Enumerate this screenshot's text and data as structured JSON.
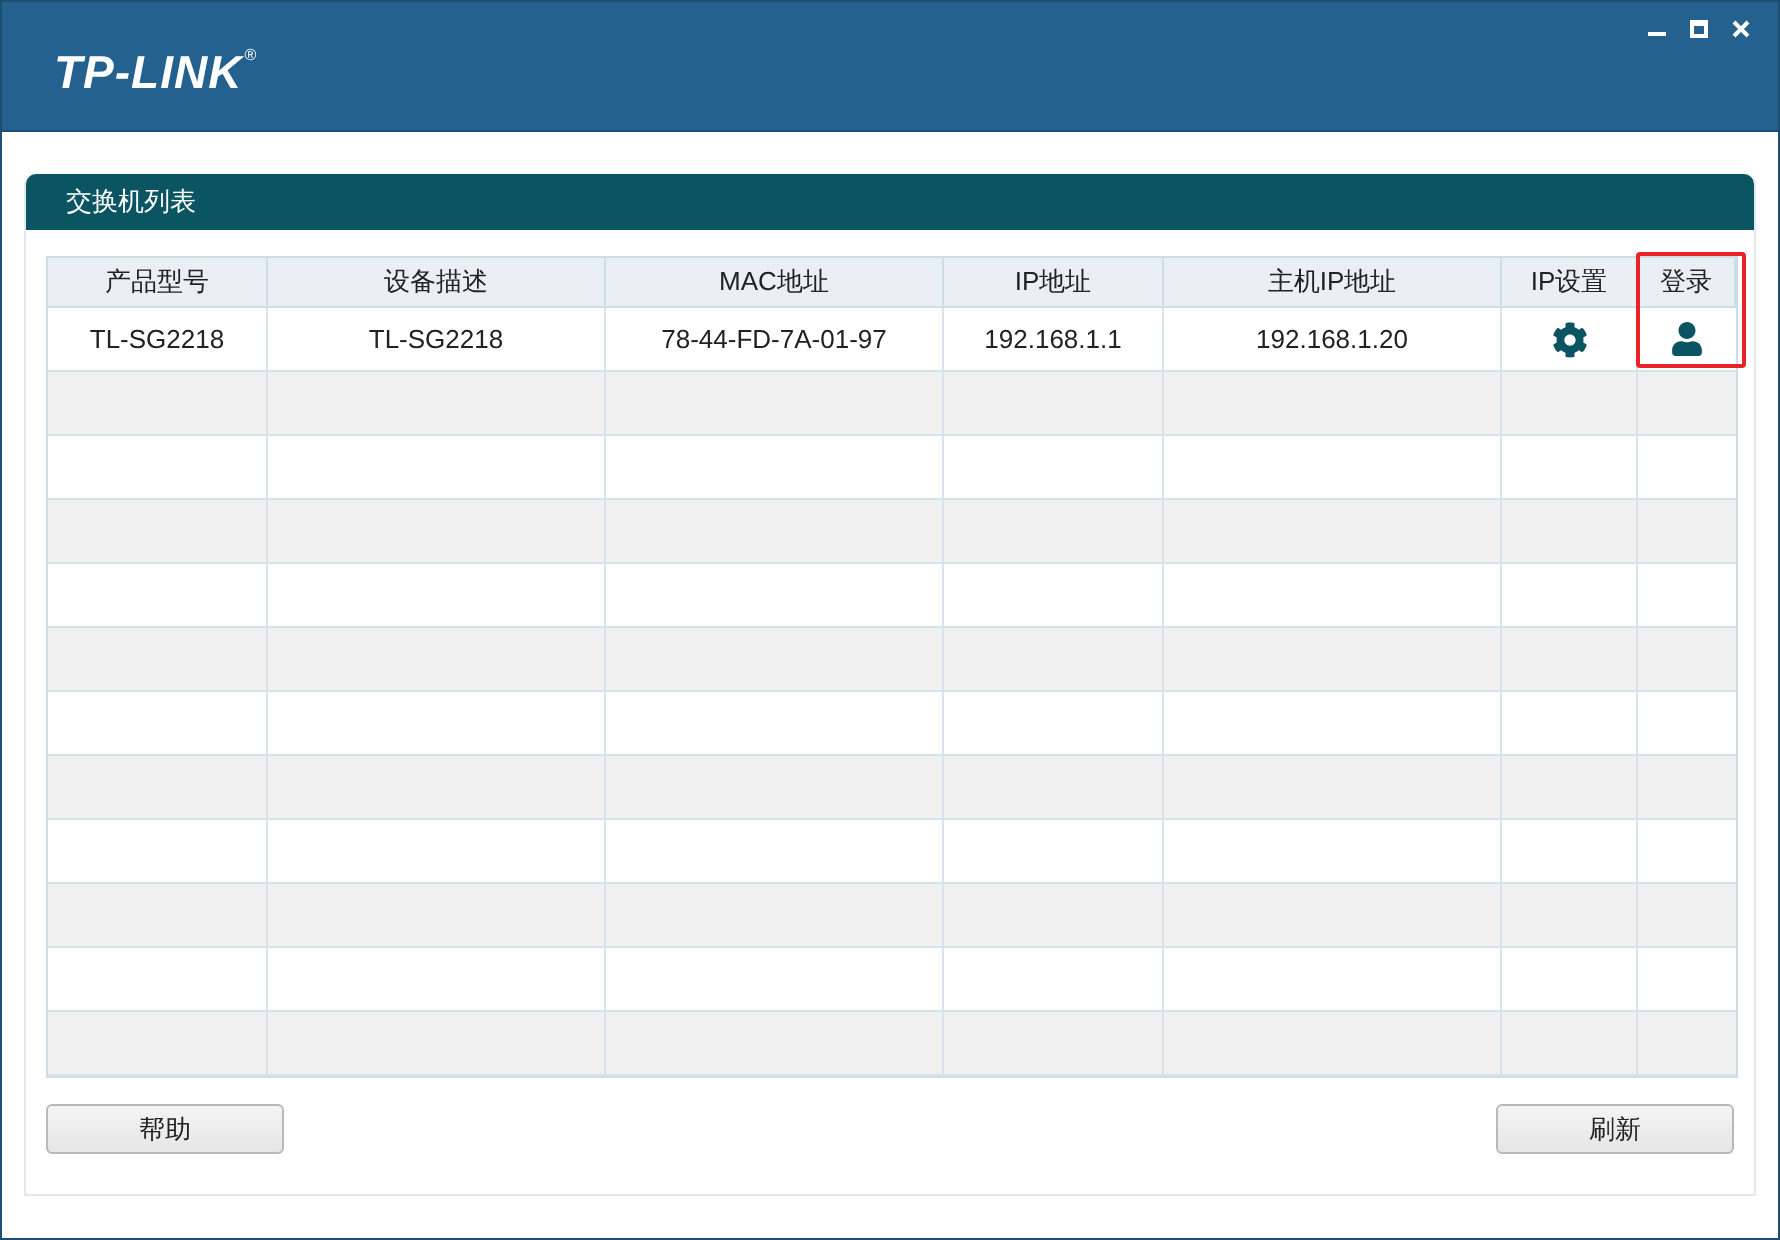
{
  "header": {
    "logo": "TP-LINK",
    "logo_mark": "®"
  },
  "panel": {
    "title": "交换机列表"
  },
  "table": {
    "columns": [
      {
        "label": "产品型号",
        "highlighted": false
      },
      {
        "label": "设备描述",
        "highlighted": false
      },
      {
        "label": "MAC地址",
        "highlighted": false
      },
      {
        "label": "IP地址",
        "highlighted": false
      },
      {
        "label": "主机IP地址",
        "highlighted": false
      },
      {
        "label": "IP设置",
        "highlighted": false
      },
      {
        "label": "登录",
        "highlighted": true
      }
    ],
    "rows": [
      {
        "cells": [
          {
            "kind": "text",
            "text": "TL-SG2218"
          },
          {
            "kind": "text",
            "text": "TL-SG2218"
          },
          {
            "kind": "text",
            "text": "78-44-FD-7A-01-97"
          },
          {
            "kind": "text",
            "text": "192.168.1.1"
          },
          {
            "kind": "text",
            "text": "192.168.1.20"
          },
          {
            "kind": "settings"
          },
          {
            "kind": "login"
          }
        ]
      }
    ]
  },
  "buttons": {
    "left": "帮助",
    "right": "刷新"
  }
}
